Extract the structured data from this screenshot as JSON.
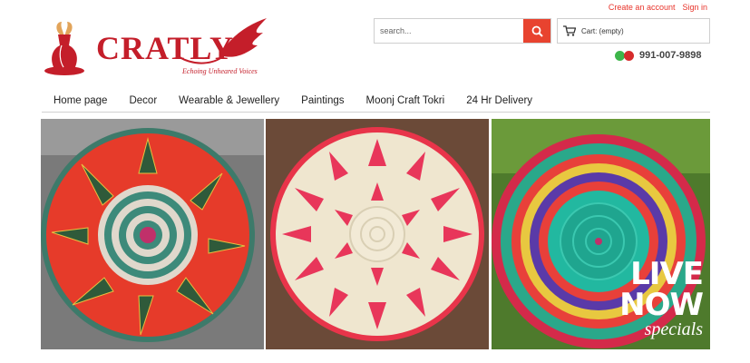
{
  "header": {
    "create_account": "Create an account",
    "sign_in": "Sign in",
    "logo_word": "CRATLY",
    "tagline": "Echoing Unheared Voices",
    "search_placeholder": "search...",
    "cart_label": "Cart: (empty)",
    "phone": "991-007-9898"
  },
  "nav": {
    "items": [
      {
        "label": "Home page"
      },
      {
        "label": "Decor"
      },
      {
        "label": "Wearable & Jewellery"
      },
      {
        "label": "Paintings"
      },
      {
        "label": "Moonj Craft Tokri"
      },
      {
        "label": "24 Hr Delivery"
      }
    ]
  },
  "banner": {
    "overlay_line1": "LIVE",
    "overlay_line2": "NOW",
    "overlay_line3": "specials"
  },
  "colors": {
    "brand_red": "#c41e2a",
    "accent_orange": "#e8432f"
  }
}
